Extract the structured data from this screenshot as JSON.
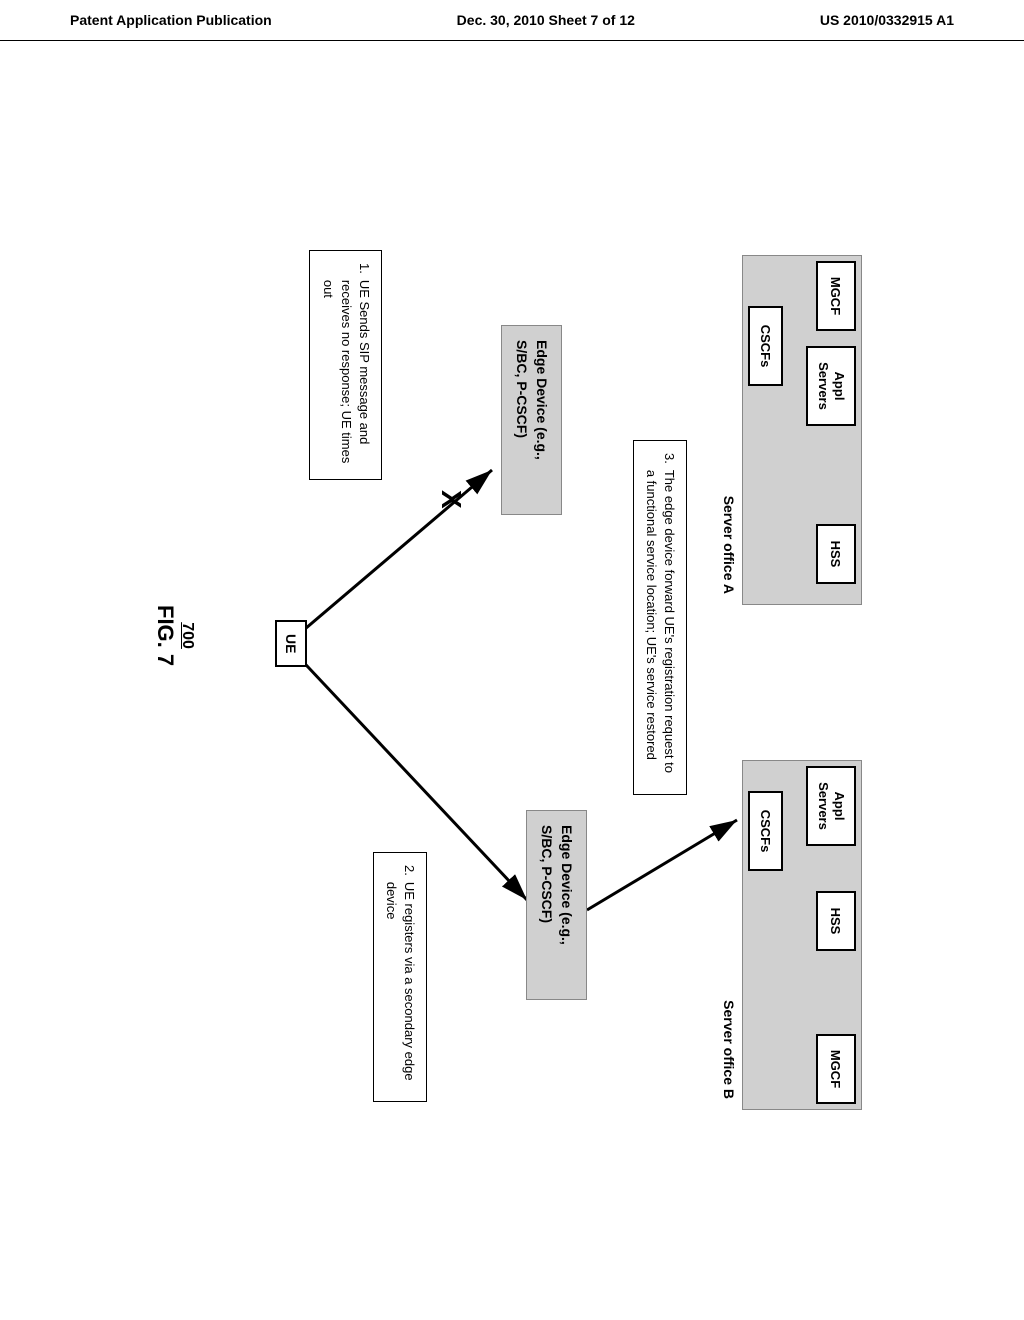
{
  "header": {
    "left": "Patent Application Publication",
    "center": "Dec. 30, 2010  Sheet 7 of 12",
    "right": "US 2010/0332915 A1"
  },
  "office_a": {
    "label": "Server office A",
    "mgcf": "MGCF",
    "appl": "Appl Servers",
    "hss": "HSS",
    "cscfs": "CSCFs"
  },
  "office_b": {
    "label": "Server office B",
    "mgcf": "MGCF",
    "appl": "Appl Servers",
    "hss": "HSS",
    "cscfs": "CSCFs"
  },
  "edge_a": "Edge Device (e.g., S/BC, P-CSCF)",
  "edge_b": "Edge Device (e.g., S/BC, P-CSCF)",
  "ue": "UE",
  "callouts": {
    "c1_num": "1.",
    "c1_text": "UE Sends SIP message and receives no response; UE times out",
    "c2_num": "2.",
    "c2_text": "UE registers via a secondary edge device",
    "c3_num": "3.",
    "c3_text": "The edge device forward UE's registration request to a functional service location; UE's service restored"
  },
  "figure": {
    "number": "700",
    "label": "FIG. 7"
  },
  "x_mark": "X"
}
